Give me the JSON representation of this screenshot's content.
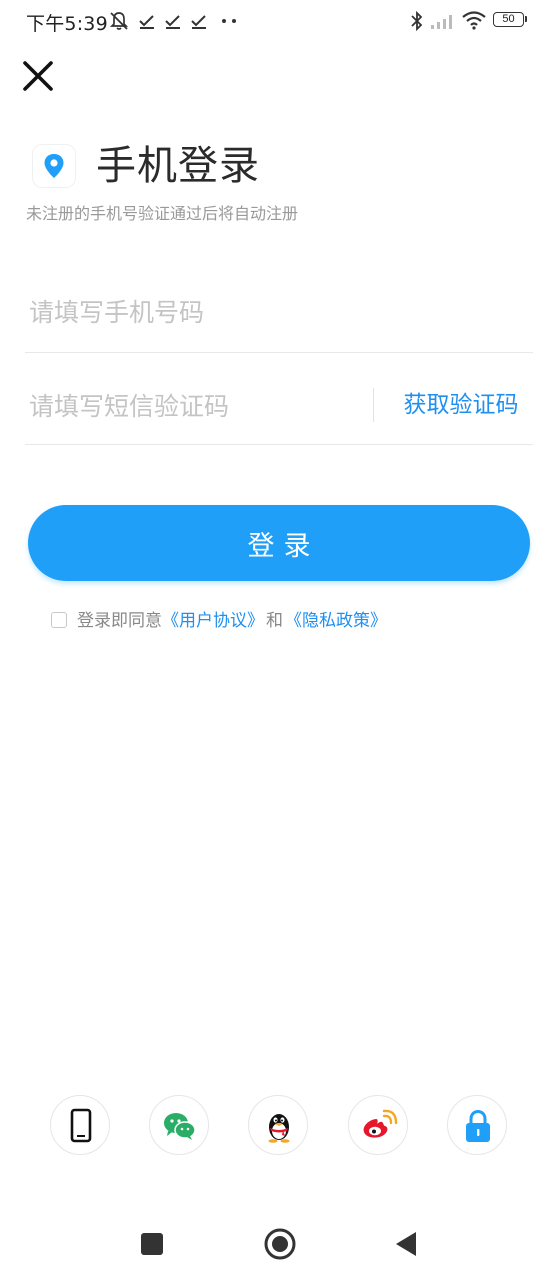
{
  "status_bar": {
    "time": "下午5:39",
    "battery_level": "50",
    "icons": [
      "bell-muted-icon",
      "check-icon",
      "check-icon",
      "check-icon",
      "more-dots-icon",
      "bluetooth-icon",
      "signal-icon",
      "wifi-icon",
      "battery-icon"
    ]
  },
  "header": {
    "title": "手机登录",
    "subtitle": "未注册的手机号验证通过后将自动注册"
  },
  "form": {
    "phone_placeholder": "请填写手机号码",
    "phone_value": "",
    "code_placeholder": "请填写短信验证码",
    "code_value": "",
    "get_code_label": "获取验证码",
    "login_label": "登录"
  },
  "agreement": {
    "prefix": "登录即同意",
    "user_agreement": "《用户协议》",
    "conjunction": "和",
    "privacy_policy": "《隐私政策》",
    "checked": false
  },
  "social_logins": [
    {
      "name": "phone-login",
      "icon": "mobile-phone-icon"
    },
    {
      "name": "wechat-login",
      "icon": "wechat-icon"
    },
    {
      "name": "qq-login",
      "icon": "qq-penguin-icon"
    },
    {
      "name": "weibo-login",
      "icon": "weibo-icon"
    },
    {
      "name": "password-login",
      "icon": "lock-icon"
    }
  ],
  "colors": {
    "accent": "#1f9ff8",
    "link": "#1f8ff0",
    "wechat": "#2aae67",
    "weibo": "#e6162d"
  }
}
